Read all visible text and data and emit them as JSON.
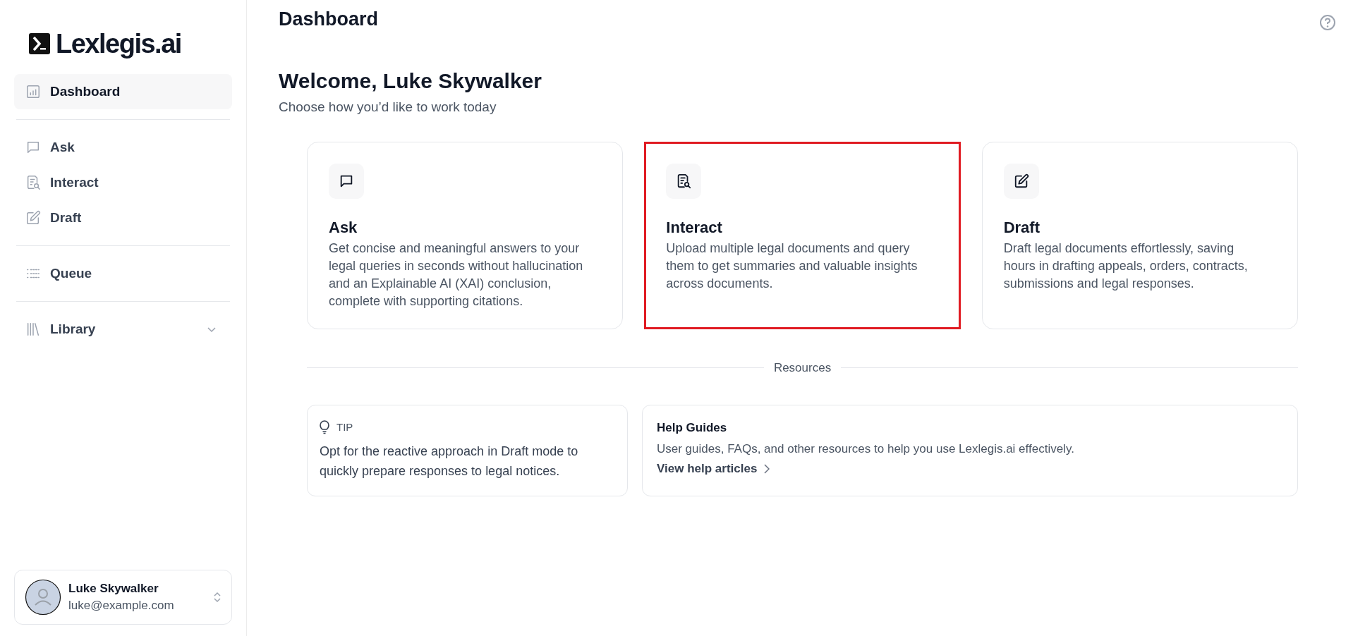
{
  "sidebar": {
    "logo": "Lexlegis.ai",
    "groups": [
      [
        {
          "label": "Dashboard",
          "selected": true,
          "kind": "link"
        }
      ],
      [
        {
          "label": "Ask",
          "selected": false,
          "kind": "link"
        },
        {
          "label": "Interact",
          "selected": false,
          "kind": "link"
        },
        {
          "label": "Draft",
          "selected": false,
          "kind": "link"
        }
      ],
      [
        {
          "label": "Queue",
          "selected": false,
          "kind": "link"
        }
      ],
      [
        {
          "label": "Library",
          "selected": false,
          "kind": "expandable",
          "expanded": false
        }
      ]
    ],
    "user": {
      "name": "Luke Skywalker",
      "email": "luke@example.com"
    }
  },
  "header": {
    "title": "Dashboard"
  },
  "welcome": {
    "title": "Welcome, Luke Skywalker",
    "subtitle": "Choose how you’d like to work today"
  },
  "cards": [
    {
      "title": "Ask",
      "description": "Get concise and meaningful answers to your legal queries in seconds without hallucination and an Explainable AI (XAI) conclusion, complete with supporting citations.",
      "highlighted": false
    },
    {
      "title": "Interact",
      "description": "Upload multiple legal documents and query them to get summaries and valuable insights across documents.",
      "highlighted": true
    },
    {
      "title": "Draft",
      "description": "Draft legal documents effortlessly, saving hours in drafting appeals, orders, contracts, submissions and legal responses.",
      "highlighted": false
    }
  ],
  "resources": {
    "heading": "Resources",
    "tip": {
      "label": "TIP",
      "text": "Opt for the reactive approach in Draft mode to quickly prepare responses to legal notices."
    },
    "help": {
      "title": "Help Guides",
      "text": "User guides, FAQs, and other resources to help you use Lexlegis.ai effectively.",
      "link": "View help articles"
    }
  }
}
